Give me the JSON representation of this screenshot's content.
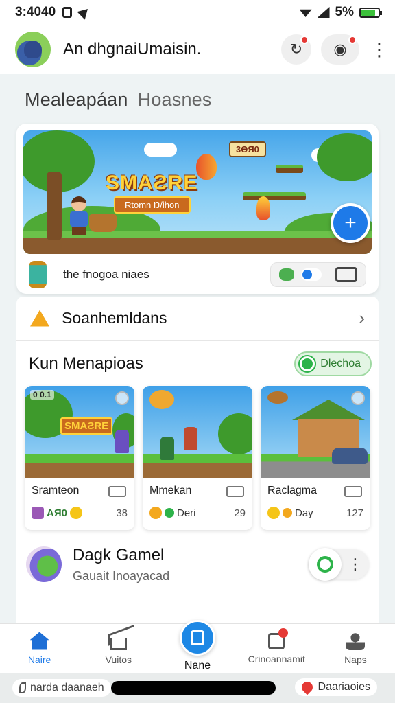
{
  "status_bar": {
    "time": "3:4040",
    "battery_text": "5%",
    "battery_level": 0.85,
    "icons": [
      "sim-icon",
      "navigation-icon",
      "wifi-icon",
      "signal-icon",
      "battery-icon"
    ]
  },
  "header": {
    "title": "An dhgnaiUmaisin."
  },
  "section": {
    "title": "Mealeapáan",
    "subtitle": "Hoasnes"
  },
  "featured": {
    "logo_text": "SMAƧRE",
    "logo_sub": "Rtomn Ŋ/ihon",
    "score_tag": "3ӨЯ0",
    "name": "the fnogoa niaes"
  },
  "row_link": {
    "label": "Soanhemldans"
  },
  "games_section": {
    "title": "Kun Menapioas",
    "chip_label": "Dlechoa"
  },
  "games": [
    {
      "hud": "0 0.1",
      "sign": "SMAƧRE",
      "title": "Sramteon",
      "stat": "AЯ0",
      "count": "38"
    },
    {
      "hud": "",
      "sign": "",
      "title": "Mmekan",
      "stat": "Deri",
      "count": "29"
    },
    {
      "hud": "",
      "sign": "",
      "title": "Raclagma",
      "stat": "Day",
      "count": "127"
    }
  ],
  "user_row": {
    "title": "Dagk Gamel",
    "subtitle": "Gauait Inoayacad"
  },
  "bottom_nav": [
    {
      "label": "Naire",
      "active": true
    },
    {
      "label": "Vuitos",
      "active": false
    },
    {
      "label": "Nane",
      "active": false
    },
    {
      "label": "Crinoannamit",
      "active": false
    },
    {
      "label": "Naps",
      "active": false
    }
  ],
  "system_bar": {
    "left_text": "narda daanaeh",
    "right_text": "Daariaoies"
  },
  "colors": {
    "accent": "#1e7ae8",
    "notification": "#e53935",
    "chip_green": "#2db34a"
  }
}
